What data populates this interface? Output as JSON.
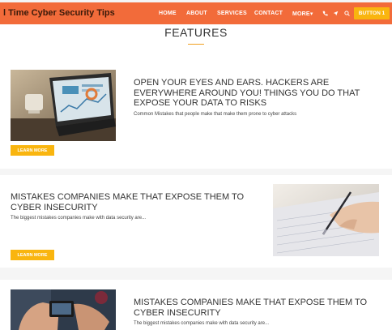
{
  "header": {
    "brand": "l Time Cyber Security Tips",
    "nav": {
      "home": "HOME",
      "about": "ABOUT",
      "services": "SERVICES",
      "contact": "CONTACT",
      "more": "MORE",
      "more_caret": "▾"
    },
    "button": "BUTTON 1"
  },
  "features": {
    "title": "FEATURES"
  },
  "cards": [
    {
      "title": "OPEN YOUR EYES AND EARS. HACKERS ARE EVERYWHERE AROUND YOU! THINGS YOU DO THAT EXPOSE YOUR DATA TO RISKS",
      "desc": "Common Mistakes that people make that make them prone to cyber attacks",
      "button": "LEARN MORE"
    },
    {
      "title": "MISTAKES COMPANIES MAKE THAT EXPOSE THEM TO CYBER INSECURITY",
      "desc": "The biggest mistakes companies make with data security are...",
      "button": "LEARN MORE"
    },
    {
      "title": "MISTAKES COMPANIES MAKE THAT EXPOSE THEM TO CYBER INSECURITY",
      "desc": "The biggest mistakes companies make with data security are..."
    }
  ],
  "colors": {
    "header_bg": "#f26b3a",
    "accent_button": "#f9b50f"
  },
  "icons": [
    "phone-icon",
    "send-icon",
    "search-icon"
  ]
}
